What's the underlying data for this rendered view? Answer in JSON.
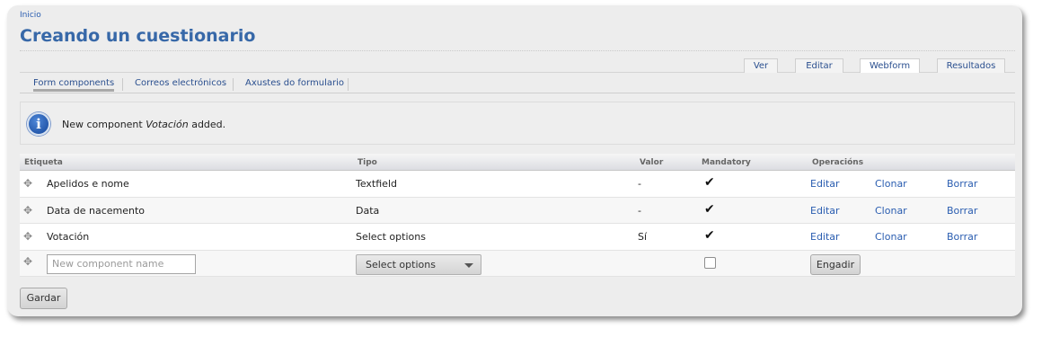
{
  "breadcrumb": "Inicio",
  "page_title": "Creando un cuestionario",
  "primary_tabs": [
    {
      "label": "Ver",
      "active": false
    },
    {
      "label": "Editar",
      "active": false
    },
    {
      "label": "Webform",
      "active": true
    },
    {
      "label": "Resultados",
      "active": false
    }
  ],
  "secondary_tabs": [
    {
      "label": "Form components",
      "active": true
    },
    {
      "label": "Correos electrónicos",
      "active": false
    },
    {
      "label": "Axustes do formulario",
      "active": false
    }
  ],
  "message": {
    "icon": "info-icon",
    "prefix": "New component ",
    "component": "Votación",
    "suffix": " added."
  },
  "table": {
    "headers": {
      "label": "Etiqueta",
      "type": "Tipo",
      "value": "Valor",
      "mandatory": "Mandatory",
      "operations": "Operacións"
    },
    "rows": [
      {
        "label": "Apelidos e nome",
        "type": "Textfield",
        "value": "-",
        "mandatory": true,
        "edit": "Editar",
        "clone": "Clonar",
        "delete": "Borrar"
      },
      {
        "label": "Data de nacemento",
        "type": "Data",
        "value": "-",
        "mandatory": true,
        "edit": "Editar",
        "clone": "Clonar",
        "delete": "Borrar"
      },
      {
        "label": "Votación",
        "type": "Select options",
        "value": "Sí",
        "mandatory": true,
        "edit": "Editar",
        "clone": "Clonar",
        "delete": "Borrar"
      }
    ],
    "new_row": {
      "name_placeholder": "New component name",
      "type_selected": "Select options",
      "mandatory": false,
      "add_label": "Engadir"
    }
  },
  "save_label": "Gardar"
}
